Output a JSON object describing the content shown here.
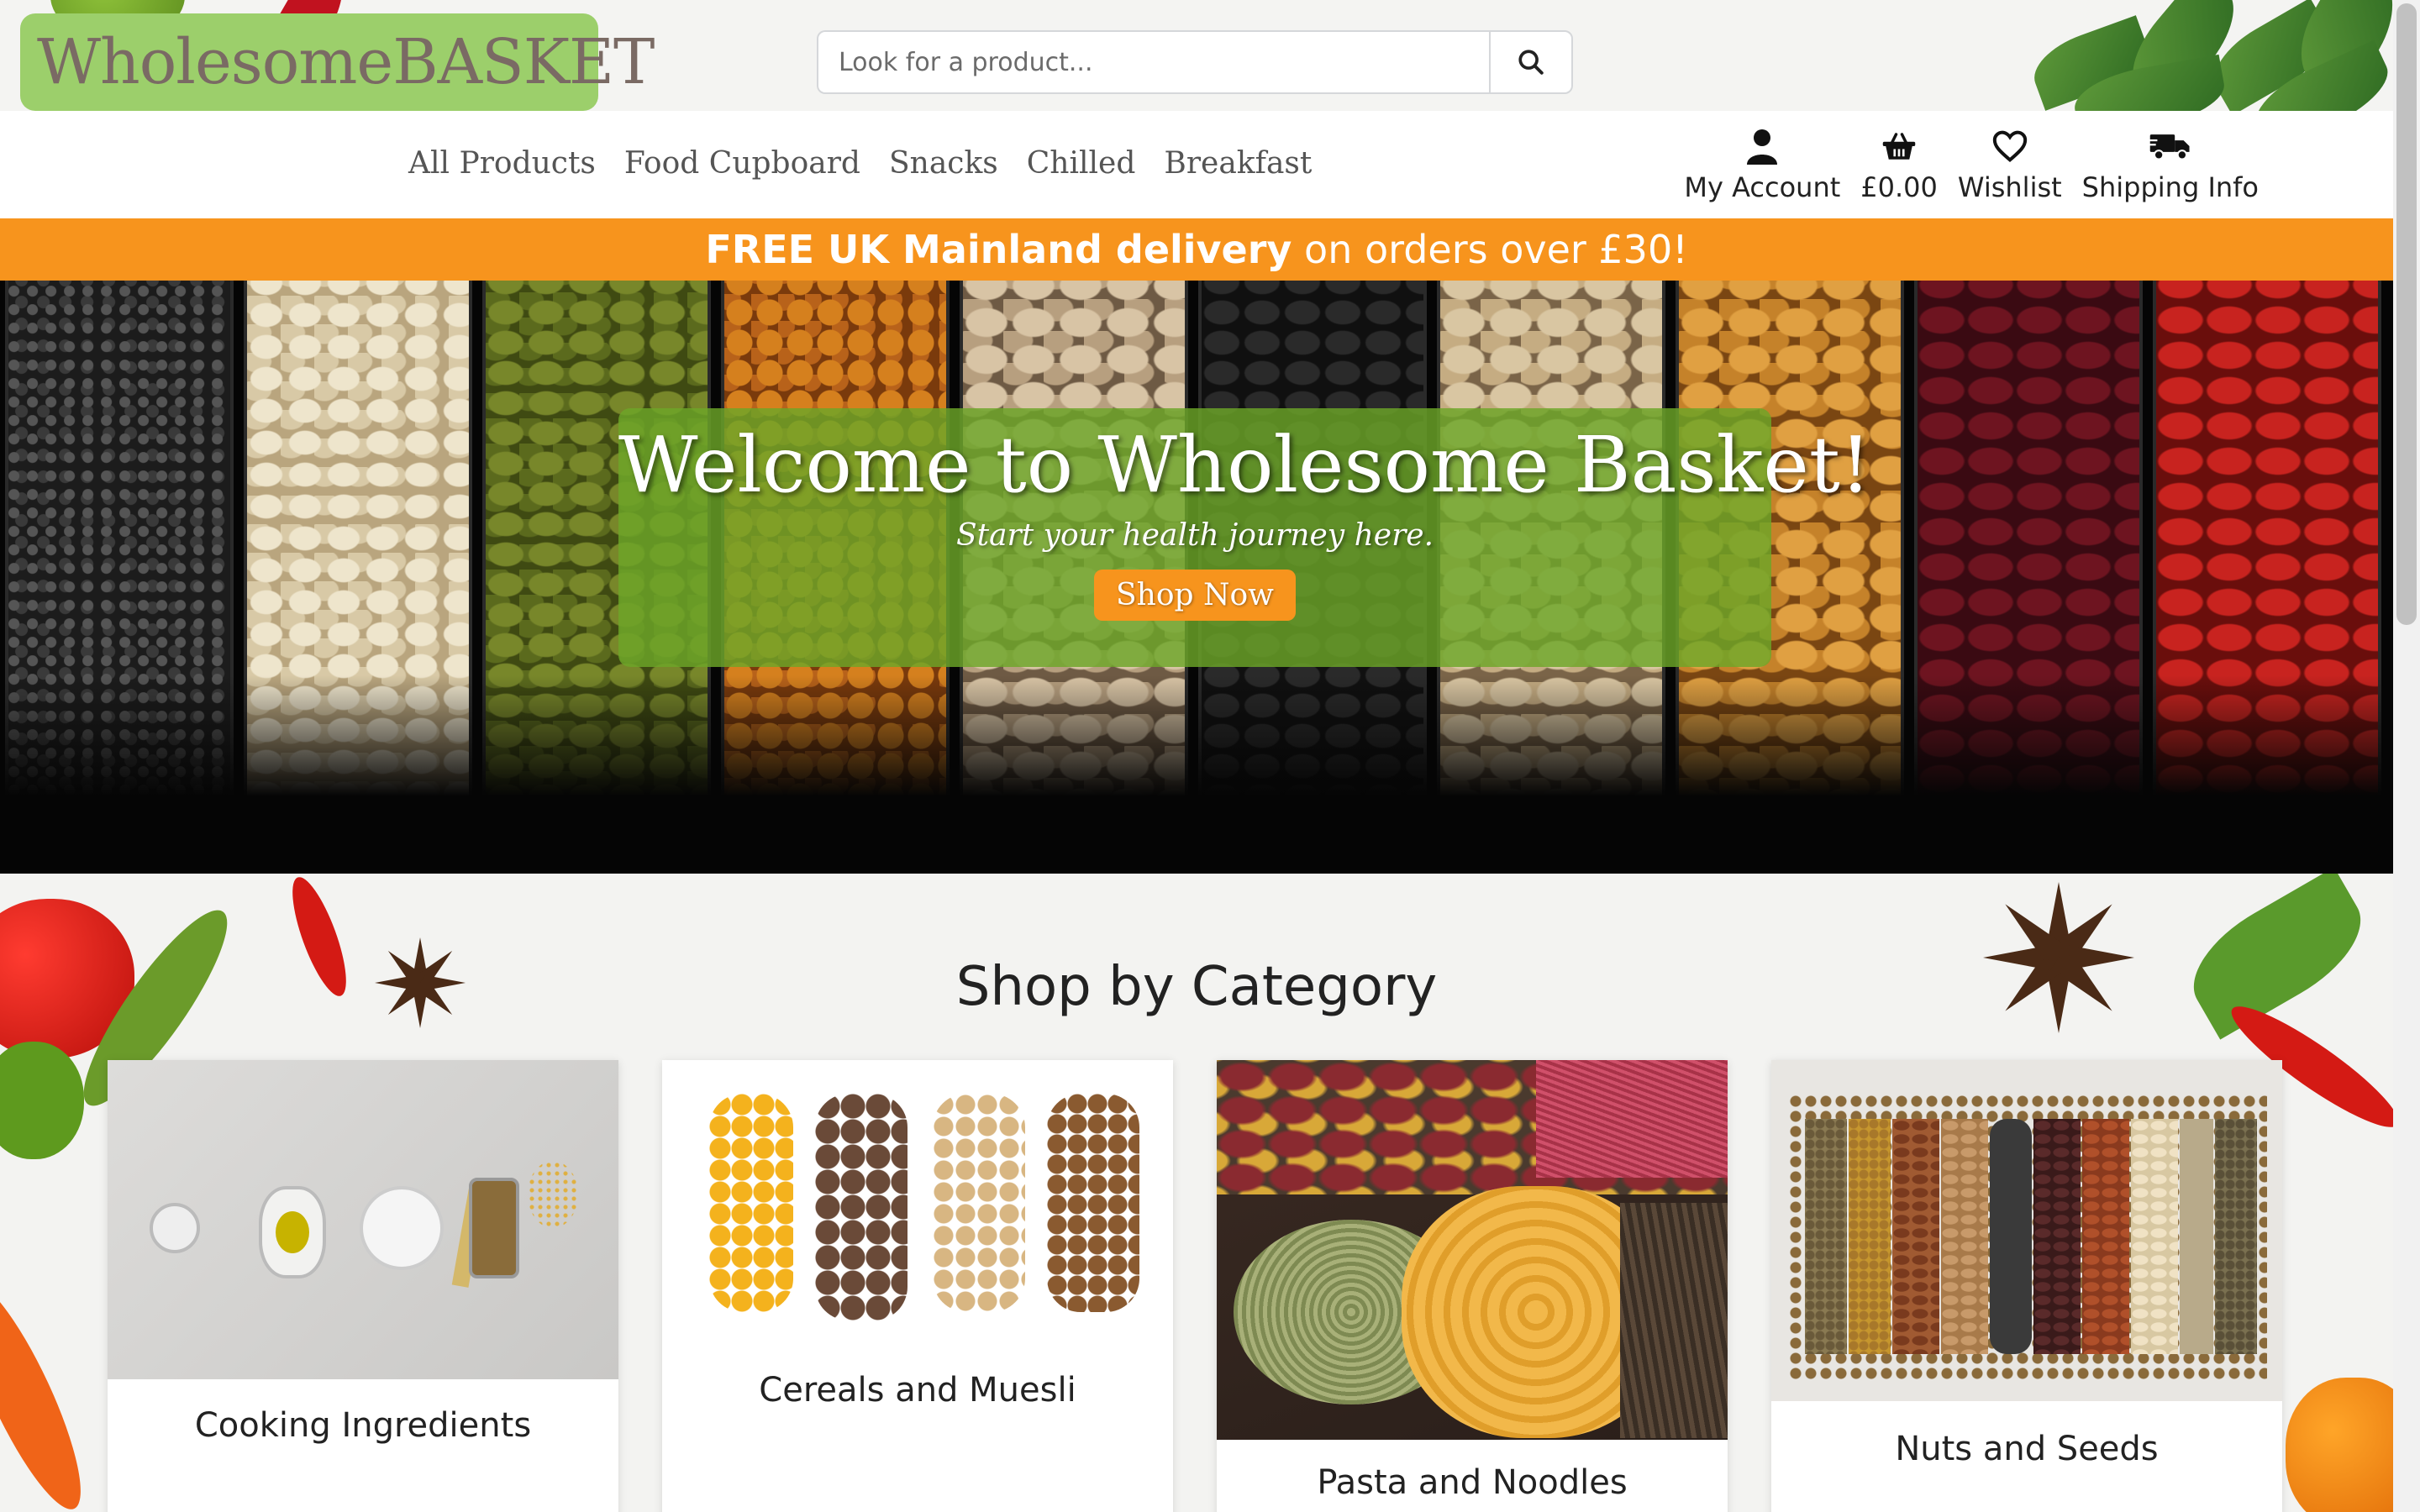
{
  "header": {
    "logo": "WholesomeBASKET",
    "search": {
      "placeholder": "Look for a product..."
    }
  },
  "nav": {
    "categories": [
      "All Products",
      "Food Cupboard",
      "Snacks",
      "Chilled",
      "Breakfast"
    ],
    "actions": [
      {
        "label": "My Account",
        "icon": "user-icon"
      },
      {
        "label": "£0.00",
        "icon": "basket-icon"
      },
      {
        "label": "Wishlist",
        "icon": "heart-icon"
      },
      {
        "label": "Shipping Info",
        "icon": "truck-icon"
      }
    ]
  },
  "promo": {
    "bold": "FREE UK Mainland delivery",
    "rest": " on orders over £30!"
  },
  "hero": {
    "title": "Welcome to Wholesome Basket!",
    "subtitle": "Start your health journey here.",
    "button": "Shop Now"
  },
  "categories_section": {
    "title": "Shop by Category",
    "cards": [
      {
        "label": "Cooking Ingredients"
      },
      {
        "label": "Cereals and Muesli"
      },
      {
        "label": "Pasta and Noodles"
      },
      {
        "label": "Nuts and Seeds"
      }
    ]
  },
  "colors": {
    "brand_green": "#9ccf6b",
    "accent_orange": "#f7941d",
    "hero_overlay": "#6ca628"
  }
}
